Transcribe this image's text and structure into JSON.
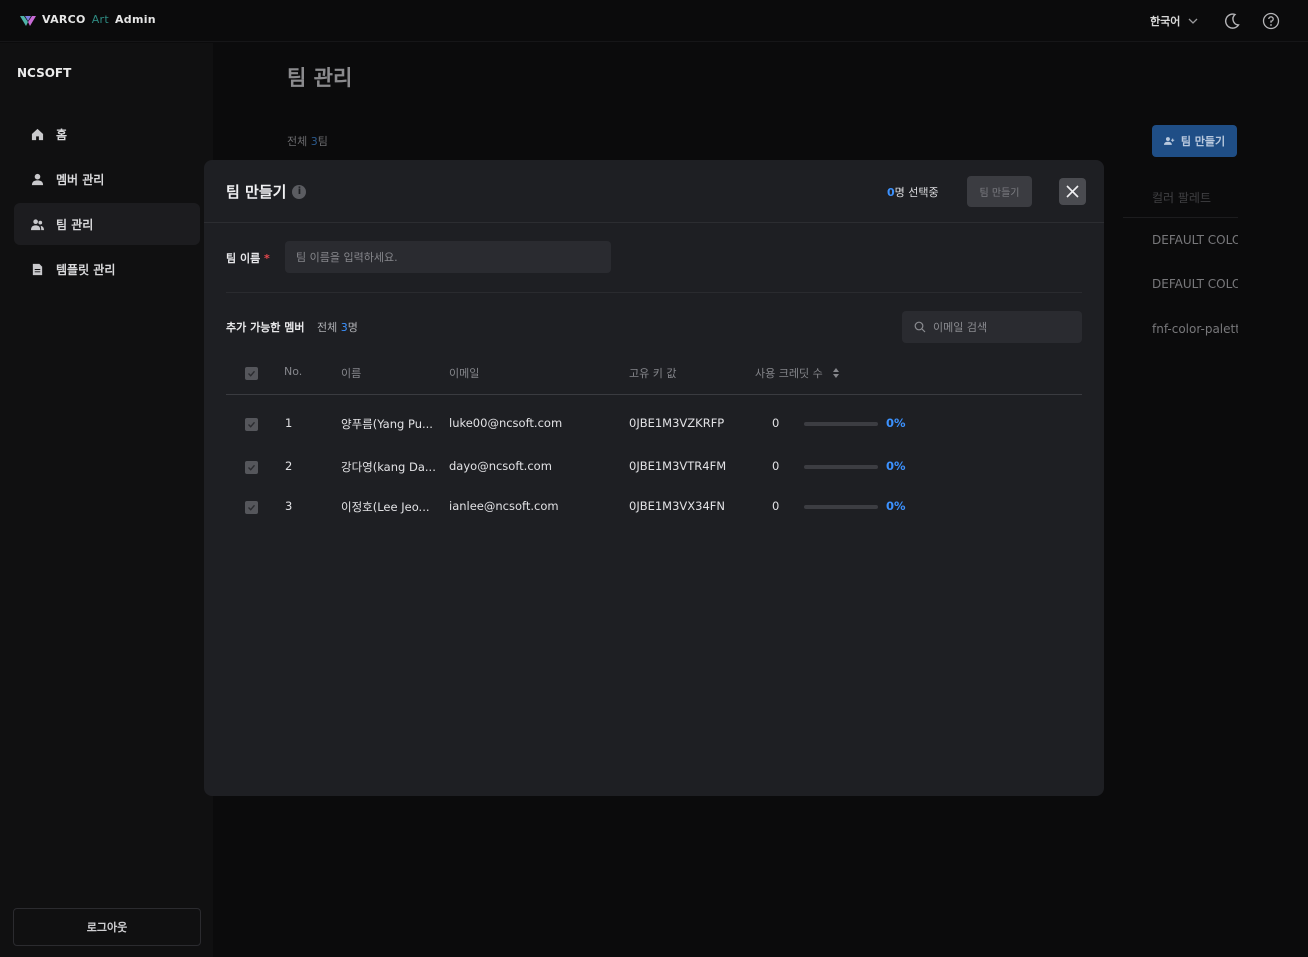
{
  "app": {
    "brand": "VARCO",
    "brand_art": "Art",
    "brand_admin": "Admin"
  },
  "topbar": {
    "language": "한국어"
  },
  "sidebar": {
    "org": "NCSOFT",
    "items": [
      {
        "label": "홈"
      },
      {
        "label": "멤버 관리"
      },
      {
        "label": "팀 관리"
      },
      {
        "label": "템플릿 관리"
      }
    ],
    "logout": "로그아웃"
  },
  "page": {
    "title": "팀 관리",
    "count_prefix": "전체 ",
    "count_num": "3",
    "count_suffix": "팀",
    "create_button": "팀 만들기",
    "column_palette": "컬러 팔레트",
    "palette_values": [
      "DEFAULT COLOR",
      "DEFAULT COLOR",
      "fnf-color-palette"
    ]
  },
  "modal": {
    "title": "팀 만들기",
    "info": "i",
    "selected_num": "0",
    "selected_suffix": "명 선택중",
    "create_button": "팀 만들기",
    "team_name_label": "팀 이름",
    "required_mark": "*",
    "team_name_placeholder": "팀 이름을 입력하세요.",
    "available_label": "추가 가능한 멤버",
    "available_prefix": "전체 ",
    "available_num": "3",
    "available_suffix": "명",
    "search_placeholder": "이메일 검색",
    "columns": {
      "no": "No.",
      "name": "이름",
      "email": "이메일",
      "key": "고유 키 값",
      "credits": "사용 크레딧 수"
    },
    "rows": [
      {
        "no": "1",
        "name": "양푸름(Yang Pu...",
        "email": "luke00@ncsoft.com",
        "key": "0JBE1M3VZKRFP",
        "credits": "0",
        "progress": 0,
        "pct": "0%"
      },
      {
        "no": "2",
        "name": "강다영(kang Da...",
        "email": "dayo@ncsoft.com",
        "key": "0JBE1M3VTR4FM",
        "credits": "0",
        "progress": 0,
        "pct": "0%"
      },
      {
        "no": "3",
        "name": "이정호(Lee Jeo...",
        "email": "ianlee@ncsoft.com",
        "key": "0JBE1M3VX34FN",
        "credits": "0",
        "progress": 0,
        "pct": "0%"
      }
    ]
  }
}
